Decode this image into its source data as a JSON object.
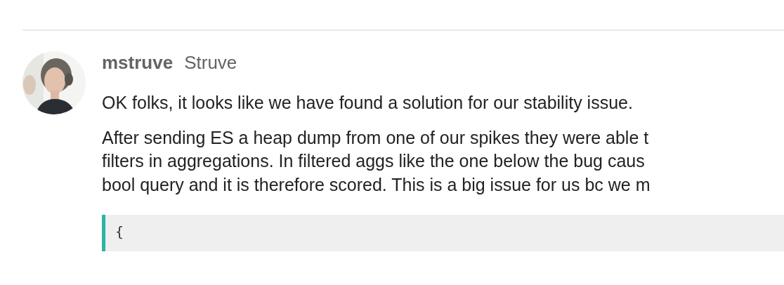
{
  "post": {
    "username": "mstruve",
    "full_name": "Struve",
    "paragraphs": [
      {
        "lines": [
          "OK folks, it looks like we have found a solution for our stability issue."
        ]
      },
      {
        "lines": [
          "After sending ES a heap dump from one of our spikes they were able t",
          "filters in aggregations. In filtered aggs like the one below the bug caus",
          "bool query and it is therefore scored. This is a big issue for us bc we m"
        ]
      }
    ],
    "code_block": {
      "lines": [
        "{"
      ]
    }
  }
}
